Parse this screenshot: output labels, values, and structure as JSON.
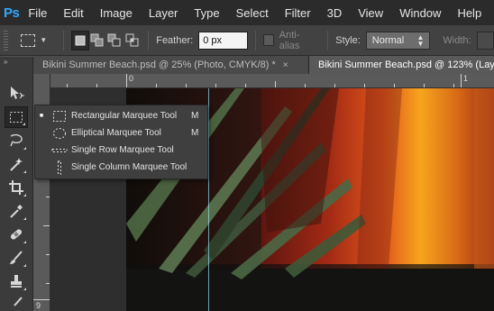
{
  "app": {
    "logo": "Ps"
  },
  "menu": [
    "File",
    "Edit",
    "Image",
    "Layer",
    "Type",
    "Select",
    "Filter",
    "3D",
    "View",
    "Window",
    "Help"
  ],
  "options": {
    "feather_label": "Feather:",
    "feather_value": "0 px",
    "antialias_label": "Anti-alias",
    "style_label": "Style:",
    "style_value": "Normal",
    "width_label": "Width:"
  },
  "toolbar": {
    "collapse": "»"
  },
  "tabs": [
    {
      "title": "Bikini Summer Beach.psd @ 25% (Photo, CMYK/8) *",
      "close": "×"
    },
    {
      "title": "Bikini Summer Beach.psd @ 123% (Lay"
    }
  ],
  "rulers": {
    "h_zero": "0",
    "h_far": "1",
    "v_bottom": "9"
  },
  "flyout": {
    "items": [
      {
        "label": "Rectangular Marquee Tool",
        "shortcut": "M",
        "selected": "■"
      },
      {
        "label": "Elliptical Marquee Tool",
        "shortcut": "M"
      },
      {
        "label": "Single Row Marquee Tool",
        "shortcut": ""
      },
      {
        "label": "Single Column Marquee Tool",
        "shortcut": ""
      }
    ]
  },
  "colors": {
    "accent": "#31a8ff",
    "guide": "#8fe3f2",
    "menubar": "#2b2b2b",
    "panel": "#535353"
  }
}
